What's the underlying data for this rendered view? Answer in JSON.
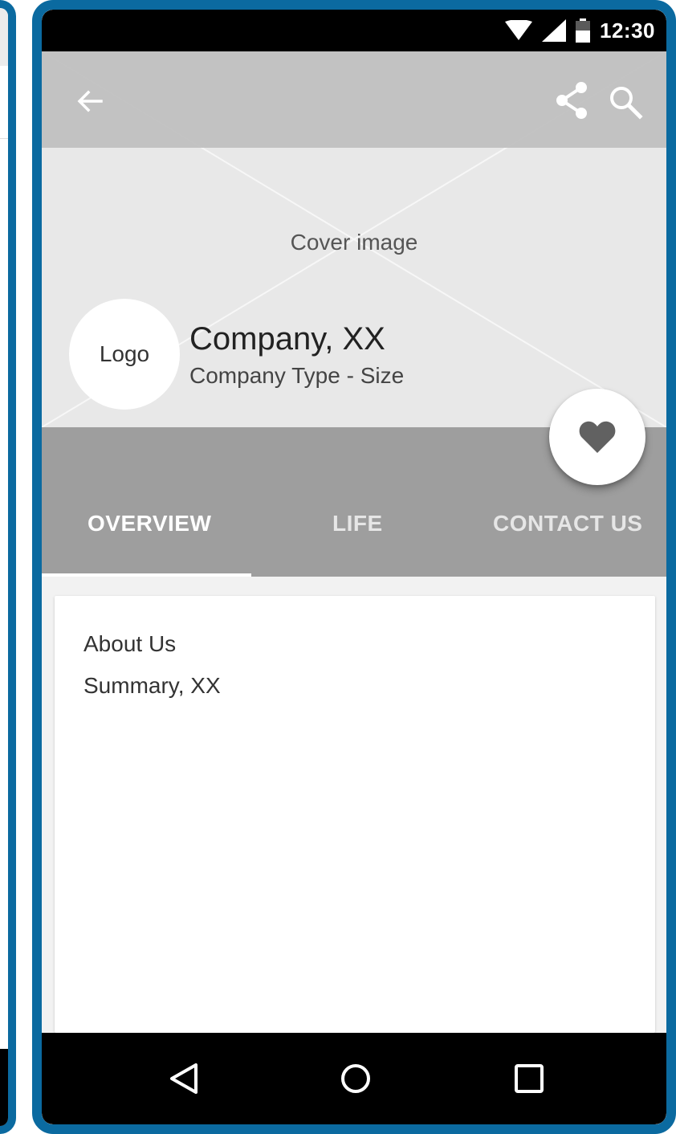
{
  "status_bar": {
    "time": "12:30"
  },
  "toolbar": {
    "icons": [
      "back-arrow-icon",
      "share-icon",
      "search-icon"
    ]
  },
  "cover": {
    "label": "Cover image"
  },
  "company": {
    "logo_label": "Logo",
    "name": "Company, XX",
    "type_size": "Company Type - Size"
  },
  "tabs": [
    {
      "label": "OVERVIEW",
      "selected": true
    },
    {
      "label": "LIFE",
      "selected": false
    },
    {
      "label": "CONTACT US",
      "selected": false
    }
  ],
  "fab": {
    "icon": "heart-icon"
  },
  "about": {
    "title": "About Us",
    "summary": "Summary, XX"
  },
  "navbar": {
    "icons": [
      "nav-back-icon",
      "nav-home-icon",
      "nav-recents-icon"
    ]
  },
  "colors": {
    "frame": "#0b6aa0",
    "tabbar": "#9e9e9e",
    "cover": "#e8e8e8",
    "toolbar": "#bebebe"
  }
}
